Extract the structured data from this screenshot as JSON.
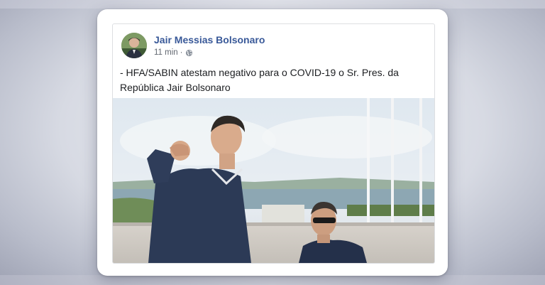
{
  "post": {
    "author": "Jair Messias Bolsonaro",
    "time": "11 min",
    "separator": "·",
    "privacy_icon": "globe-icon",
    "text": "- HFA/SABIN atestam negativo para o COVID-19 o Sr. Pres. da República Jair Bolsonaro"
  },
  "colors": {
    "author_link": "#385898",
    "meta": "#616770",
    "body_text": "#1c1e21"
  }
}
